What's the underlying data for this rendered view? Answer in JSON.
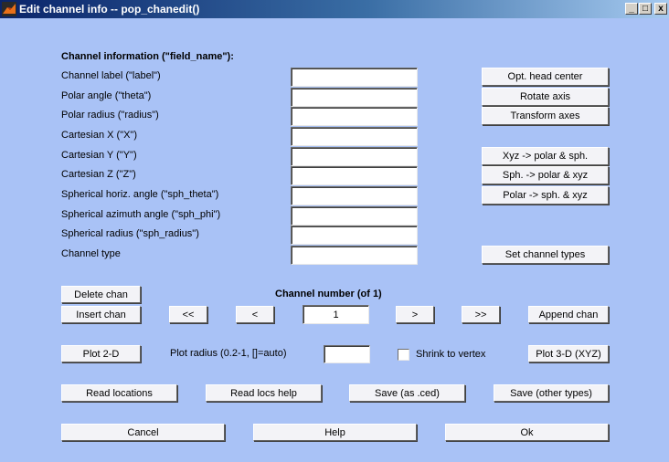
{
  "window": {
    "title": "Edit channel info -- pop_chanedit()",
    "minimize": "_",
    "maximize": "□",
    "close": "x"
  },
  "section_title": "Channel information (\"field_name\"):",
  "fields": [
    {
      "label": "Channel label (\"label\")",
      "value": ""
    },
    {
      "label": "Polar angle (\"theta\")",
      "value": ""
    },
    {
      "label": "Polar radius (\"radius\")",
      "value": ""
    },
    {
      "label": "Cartesian X (\"X\")",
      "value": ""
    },
    {
      "label": "Cartesian Y (\"Y\")",
      "value": ""
    },
    {
      "label": "Cartesian Z (\"Z\")",
      "value": ""
    },
    {
      "label": "Spherical horiz. angle (\"sph_theta\")",
      "value": ""
    },
    {
      "label": "Spherical azimuth angle (\"sph_phi\")",
      "value": ""
    },
    {
      "label": "Spherical radius (\"sph_radius\")",
      "value": ""
    },
    {
      "label": "Channel type",
      "value": ""
    }
  ],
  "side_buttons": {
    "opt_head_center": "Opt. head center",
    "rotate_axis": "Rotate axis",
    "transform_axes": "Transform axes",
    "xyz_to_polar_sph": "Xyz -> polar & sph.",
    "sph_to_polar_xyz": "Sph. -> polar & xyz",
    "polar_to_sph_xyz": "Polar -> sph. & xyz",
    "set_channel_types": "Set channel types"
  },
  "navigation": {
    "delete_chan": "Delete chan",
    "insert_chan": "Insert chan",
    "channel_number_label": "Channel number (of 1)",
    "first": "<<",
    "prev": "<",
    "channel_number": "1",
    "next": ">",
    "last": ">>",
    "append_chan": "Append chan"
  },
  "plot": {
    "plot_2d": "Plot 2-D",
    "radius_label": "Plot radius (0.2-1, []=auto)",
    "radius_value": "",
    "shrink_label": "Shrink to vertex",
    "plot_3d": "Plot 3-D (XYZ)"
  },
  "io_buttons": {
    "read_locations": "Read locations",
    "read_locs_help": "Read locs help",
    "save_ced": "Save (as .ced)",
    "save_other": "Save (other types)"
  },
  "footer": {
    "cancel": "Cancel",
    "help": "Help",
    "ok": "Ok"
  },
  "colors": {
    "background": "#a9c2f6",
    "button_face": "#f3f3f7",
    "title_bar": "#0a246a"
  }
}
